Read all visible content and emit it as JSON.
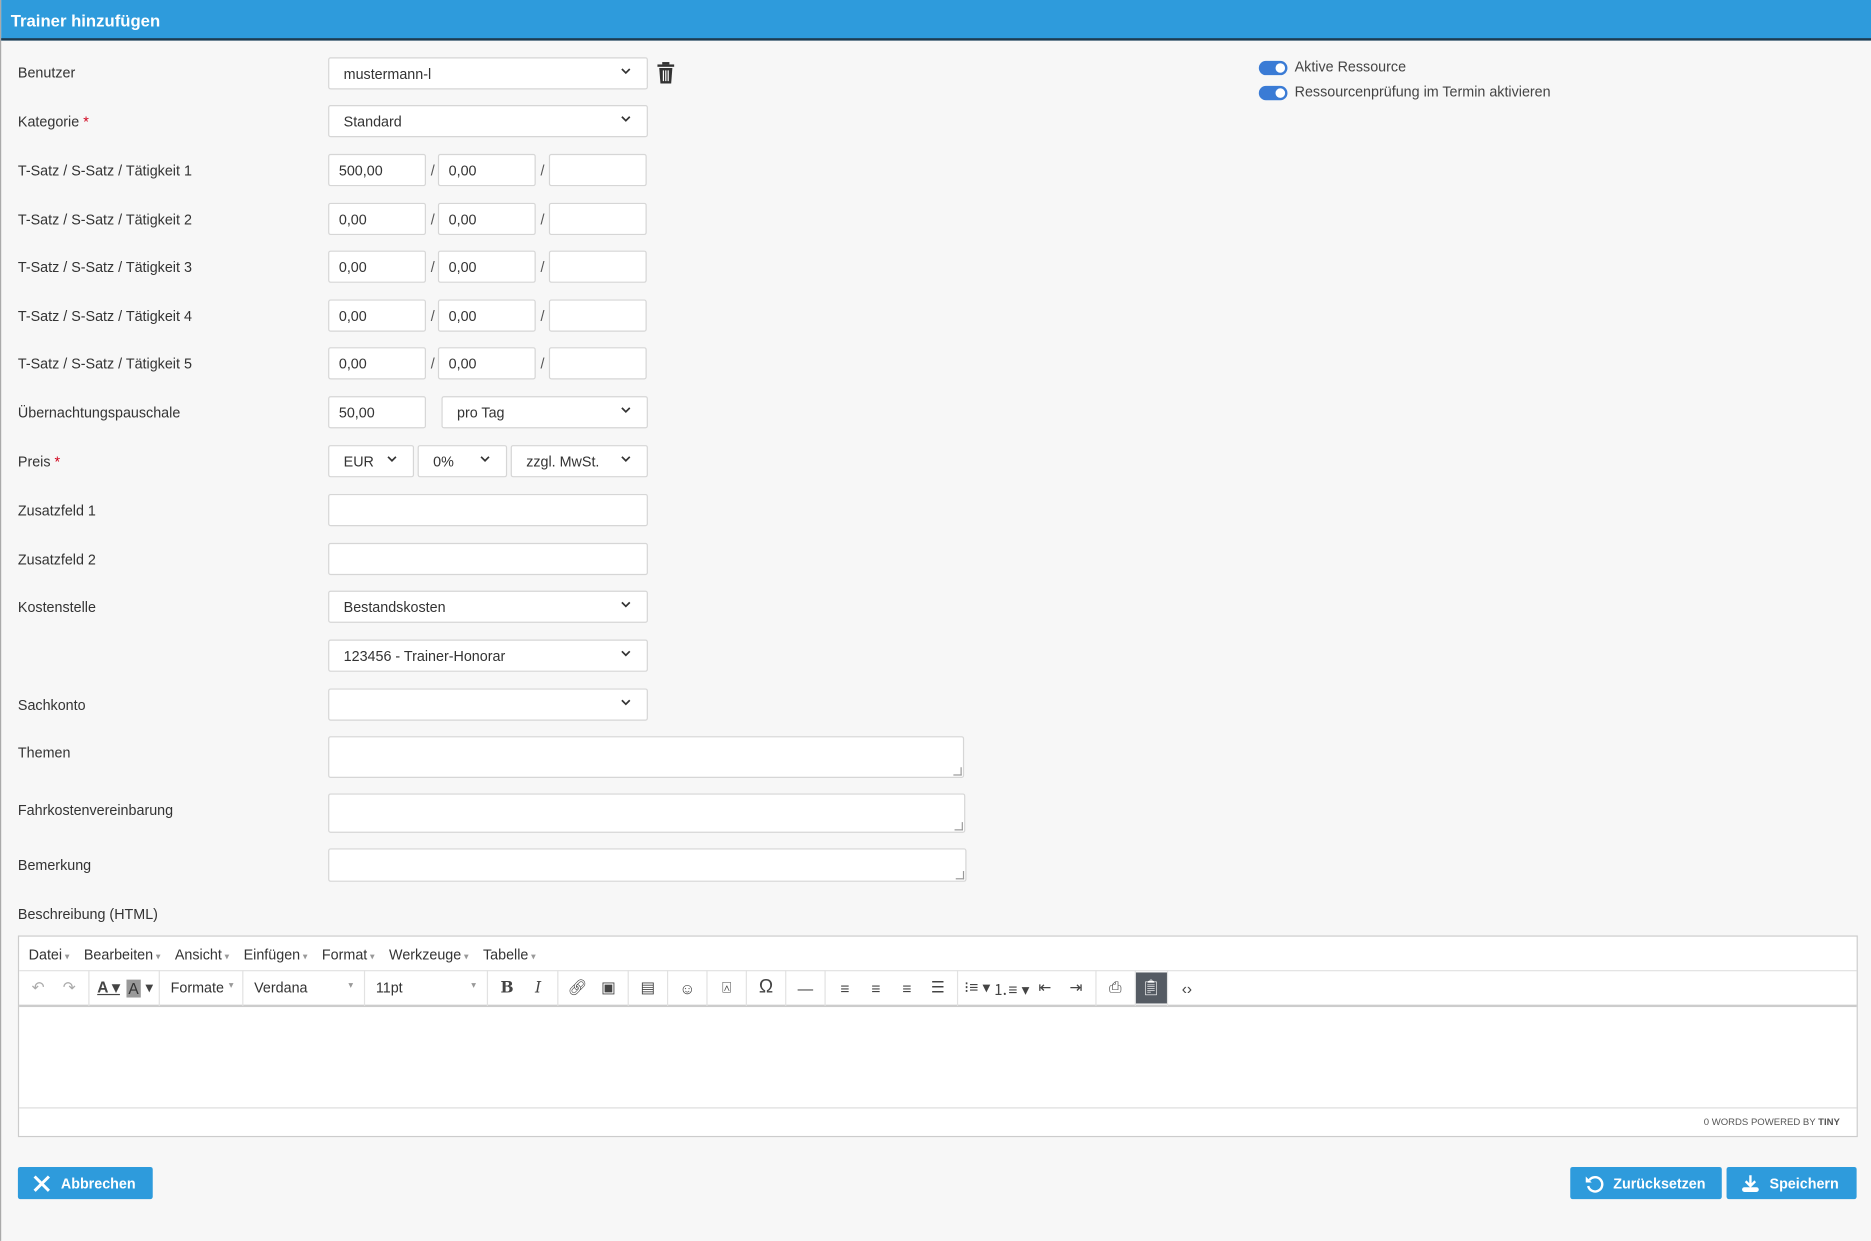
{
  "header": {
    "title": "Trainer hinzufügen"
  },
  "form": {
    "benutzer": {
      "label": "Benutzer",
      "value": "mustermann-l"
    },
    "kategorie": {
      "label": "Kategorie",
      "required": "*",
      "value": "Standard"
    },
    "rates": [
      {
        "label": "T-Satz / S-Satz / Tätigkeit 1",
        "t": "500,00",
        "s": "0,00",
        "taetigkeit": ""
      },
      {
        "label": "T-Satz / S-Satz / Tätigkeit 2",
        "t": "0,00",
        "s": "0,00",
        "taetigkeit": ""
      },
      {
        "label": "T-Satz / S-Satz / Tätigkeit 3",
        "t": "0,00",
        "s": "0,00",
        "taetigkeit": ""
      },
      {
        "label": "T-Satz / S-Satz / Tätigkeit 4",
        "t": "0,00",
        "s": "0,00",
        "taetigkeit": ""
      },
      {
        "label": "T-Satz / S-Satz / Tätigkeit 5",
        "t": "0,00",
        "s": "0,00",
        "taetigkeit": ""
      }
    ],
    "separator": "/",
    "uebernachtung": {
      "label": "Übernachtungspauschale",
      "value": "50,00",
      "unit": "pro Tag"
    },
    "preis": {
      "label": "Preis",
      "required": "*",
      "currency": "EUR",
      "tax": "0%",
      "tax_mode": "zzgl. MwSt."
    },
    "zusatz1": {
      "label": "Zusatzfeld 1",
      "value": ""
    },
    "zusatz2": {
      "label": "Zusatzfeld 2",
      "value": ""
    },
    "kostenstelle": {
      "label": "Kostenstelle",
      "value": "Bestandskosten",
      "sub_value": "123456 - Trainer-Honorar"
    },
    "sachkonto": {
      "label": "Sachkonto",
      "value": ""
    },
    "themen": {
      "label": "Themen"
    },
    "fahrkosten": {
      "label": "Fahrkostenvereinbarung"
    },
    "bemerkung": {
      "label": "Bemerkung"
    },
    "beschreibung": {
      "label": "Beschreibung (HTML)"
    }
  },
  "toggles": [
    {
      "label": "Aktive Ressource",
      "on": true
    },
    {
      "label": "Ressourcenprüfung im Termin aktivieren",
      "on": true
    }
  ],
  "editor": {
    "menu": [
      "Datei",
      "Bearbeiten",
      "Ansicht",
      "Einfügen",
      "Format",
      "Werkzeuge",
      "Tabelle"
    ],
    "formats": "Formate",
    "font": "Verdana",
    "size": "11pt",
    "status": "0 WORDS POWERED BY",
    "brand": "TINY"
  },
  "buttons": {
    "cancel": "Abbrechen",
    "reset": "Zurücksetzen",
    "save": "Speichern"
  },
  "colors": {
    "primary": "#2e9bdc",
    "toggle": "#3a7bd5"
  }
}
